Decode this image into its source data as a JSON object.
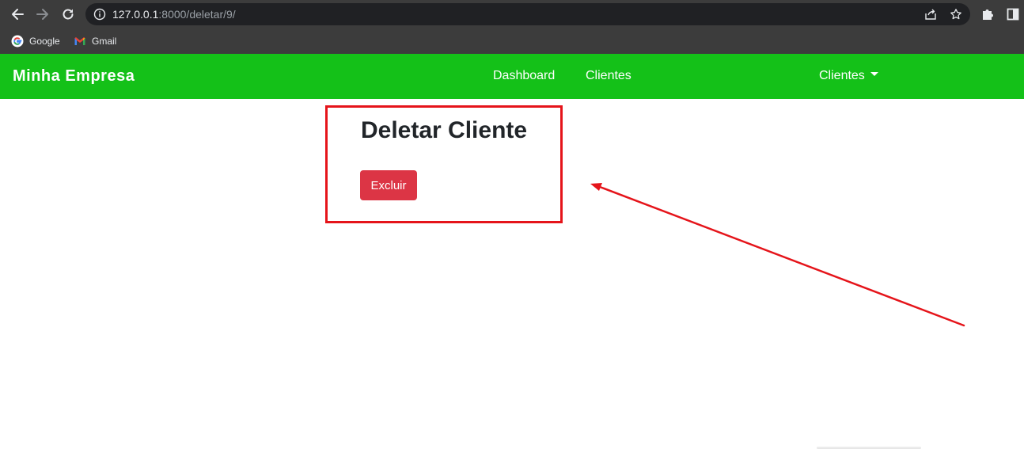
{
  "browser": {
    "url_host": "127.0.0.1",
    "url_rest": ":8000/deletar/9/",
    "bookmarks": [
      {
        "label": "Google",
        "icon": "google-icon"
      },
      {
        "label": "Gmail",
        "icon": "gmail-icon"
      }
    ],
    "icons": {
      "back": "arrow-left-icon",
      "forward": "arrow-right-icon",
      "reload": "reload-icon",
      "info": "info-icon",
      "share": "share-icon",
      "bookmark": "star-icon",
      "extensions": "puzzle-icon",
      "side_panel": "side-panel-icon"
    }
  },
  "navbar": {
    "brand": "Minha Empresa",
    "links": [
      "Dashboard",
      "Clientes"
    ],
    "dropdown": "Clientes",
    "color": "#14c118"
  },
  "main": {
    "title": "Deletar Cliente",
    "delete_button": "Excluir",
    "button_color": "#dc3545"
  },
  "annotation": {
    "color": "#e5141a",
    "shapes": [
      "highlight-box",
      "arrow"
    ]
  }
}
